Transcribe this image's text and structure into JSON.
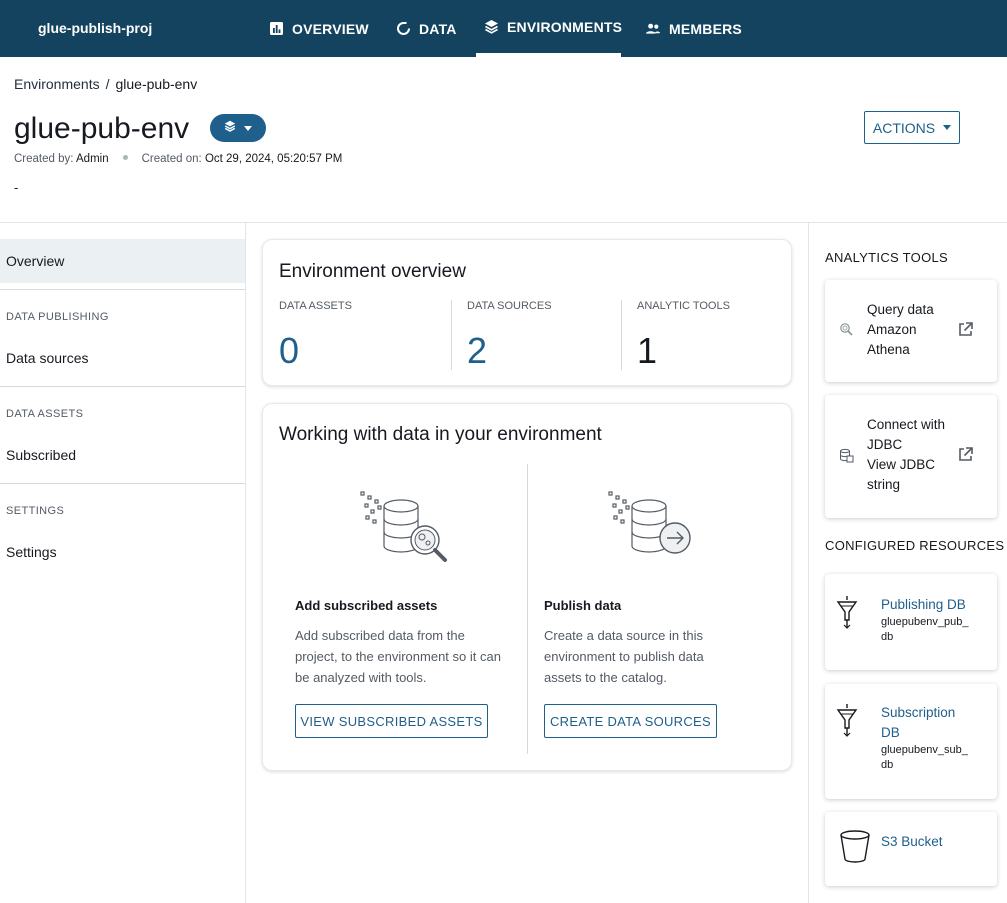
{
  "nav": {
    "project": "glue-publish-proj",
    "tabs": [
      {
        "label": "OVERVIEW",
        "icon": "chart-icon"
      },
      {
        "label": "DATA",
        "icon": "circle-arrow-icon"
      },
      {
        "label": "ENVIRONMENTS",
        "icon": "layers-icon",
        "active": true
      },
      {
        "label": "MEMBERS",
        "icon": "people-icon"
      }
    ]
  },
  "breadcrumb": {
    "root": "Environments",
    "separator": "/",
    "current": "glue-pub-env"
  },
  "header": {
    "title": "glue-pub-env",
    "created_by_label": "Created by:",
    "created_by": "Admin",
    "created_on_label": "Created on:",
    "created_on": "Oct 29, 2024, 05:20:57 PM",
    "description": "-",
    "actions_label": "ACTIONS"
  },
  "sidebar": {
    "overview": "Overview",
    "sections": [
      {
        "title": "DATA PUBLISHING",
        "item": "Data sources"
      },
      {
        "title": "DATA ASSETS",
        "item": "Subscribed"
      },
      {
        "title": "SETTINGS",
        "item": "Settings"
      }
    ]
  },
  "overview_card": {
    "title": "Environment overview",
    "stats": [
      {
        "label": "DATA ASSETS",
        "value": "0",
        "color": "#1f5f8b"
      },
      {
        "label": "DATA SOURCES",
        "value": "2",
        "color": "#1f5f8b"
      },
      {
        "label": "ANALYTIC TOOLS",
        "value": "1",
        "color": "#16191f"
      }
    ]
  },
  "working_card": {
    "title": "Working with data in your environment",
    "left": {
      "title": "Add subscribed assets",
      "text": "Add subscribed data from the project, to the environment so it can be analyzed with tools.",
      "button": "VIEW SUBSCRIBED ASSETS"
    },
    "right": {
      "title": "Publish data",
      "text": "Create a data source in this environment to publish data assets to the catalog.",
      "button": "CREATE DATA SOURCES"
    }
  },
  "analytics": {
    "heading": "ANALYTICS TOOLS",
    "tools": [
      {
        "line1": "Query data",
        "line2": "Amazon",
        "line3": "Athena"
      },
      {
        "line1": "Connect with",
        "line2": "JDBC",
        "line3": "View JDBC",
        "line4": "string"
      }
    ]
  },
  "resources": {
    "heading": "CONFIGURED RESOURCES",
    "items": [
      {
        "name": "Publishing DB",
        "sub1": "gluepubenv_pub_",
        "sub2": "db"
      },
      {
        "name1": "Subscription",
        "name2": "DB",
        "sub1": "gluepubenv_sub_",
        "sub2": "db"
      },
      {
        "name": "S3 Bucket"
      }
    ]
  },
  "colors": {
    "nav_bg": "#13435f",
    "accent": "#1f5f8b",
    "active_side": "#ebf1f3"
  }
}
